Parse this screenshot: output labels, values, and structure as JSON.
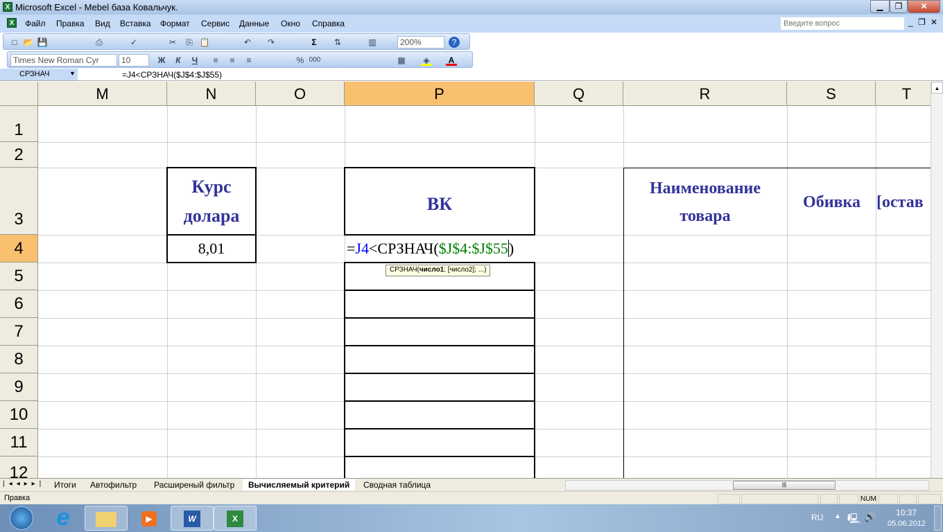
{
  "window": {
    "title": "Microsoft Excel - Mebel база Ковальчук.",
    "app_icon": "excel-icon"
  },
  "menu": [
    "Файл",
    "Правка",
    "Вид",
    "Вставка",
    "Формат",
    "Сервис",
    "Данные",
    "Окно",
    "Справка"
  ],
  "help_box": {
    "placeholder": "Введите вопрос"
  },
  "toolbar": {
    "zoom": "200%",
    "font": "Times New Roman Cyr",
    "size": "10",
    "bold": "Ж",
    "italic": "К",
    "underline": "Ч",
    "percent": "%",
    "thousands": "000",
    "sigma": "Σ"
  },
  "formula_bar": {
    "name_box": "СРЗНАЧ",
    "formula": "=J4<СРЗНАЧ($J$4:$J$55)"
  },
  "columns": [
    "M",
    "N",
    "O",
    "P",
    "Q",
    "R",
    "S",
    "T"
  ],
  "rows": [
    "1",
    "2",
    "3",
    "4",
    "5",
    "6",
    "7",
    "8",
    "9",
    "10",
    "11",
    "12"
  ],
  "cells": {
    "N3": "Курс долара",
    "N4": "8,01",
    "P3": "ВК",
    "R3": "Наименование товара",
    "S3": "Обивка",
    "T3": "[остав"
  },
  "edit": {
    "eq": "=",
    "ref": "J4",
    "op": "<СРЗНАЧ(",
    "range": "$J$4:$J$55",
    "close": ")",
    "tooltip_fn": "СРЗНАЧ(",
    "tooltip_arg1": "число1",
    "tooltip_rest": "; [число2]; ...)"
  },
  "colors": {
    "ref": "#0000ff",
    "range": "#008000",
    "header_text": "#333399",
    "selected_header": "#f9c070"
  },
  "sheet_tabs": [
    "Итоги",
    "Автофильтр",
    "Расширеный фильтр",
    "Вычисляемый критерий",
    "Сводная таблица"
  ],
  "active_tab": "Вычисляемый критерий",
  "status": {
    "mode": "Правка",
    "num": "NUM"
  },
  "taskbar": {
    "lang": "RU",
    "time": "10:37",
    "date": "05.06.2012"
  }
}
